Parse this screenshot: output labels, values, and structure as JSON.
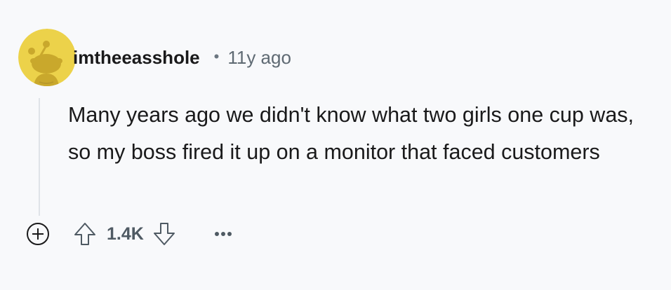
{
  "comment": {
    "username": "imtheeasshole",
    "separator": "•",
    "timestamp": "11y ago",
    "body": "Many years ago we didn't know what two girls one cup was, so my boss fired it up on a monitor that faced customers",
    "score": "1.4K"
  },
  "icons": {
    "avatar": "reddit-snoo-avatar",
    "expand": "plus-circle-icon",
    "upvote": "upvote-arrow-icon",
    "downvote": "downvote-arrow-icon",
    "more": "more-options-icon"
  },
  "colors": {
    "background": "#f8f9fb",
    "avatar_bg": "#ecd24a",
    "text": "#1a1a1b",
    "muted": "#5f6a73"
  }
}
